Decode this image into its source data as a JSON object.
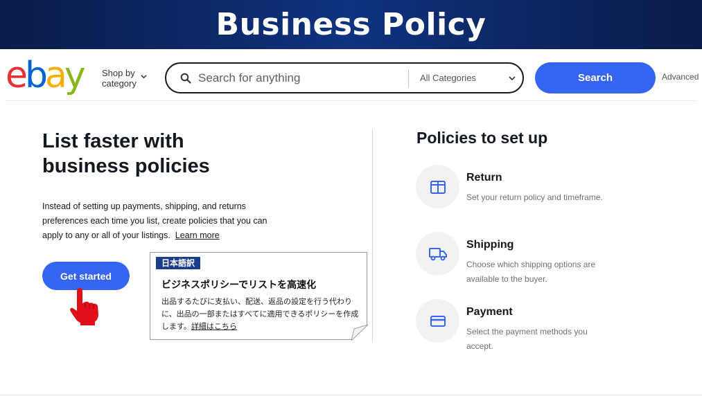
{
  "banner": {
    "title": "Business Policy"
  },
  "header": {
    "logo": {
      "e": "e",
      "b": "b",
      "a": "a",
      "y": "y"
    },
    "shop_by_line1": "Shop by",
    "shop_by_line2": "category",
    "search_placeholder": "Search for anything",
    "category_select": "All Categories",
    "search_button": "Search",
    "advanced_link": "Advanced"
  },
  "hero": {
    "title_line1": "List faster with",
    "title_line2": "business policies",
    "description": "Instead of setting up payments, shipping, and returns preferences each time you list, create policies that you can apply to any or all of your listings.",
    "learn_more": "Learn more",
    "get_started": "Get started"
  },
  "jp_note": {
    "tag": "日本語訳",
    "title": "ビジネスポリシーでリストを高速化",
    "body": "出品するたびに支払い、配送、返品の設定を行う代わりに、出品の一部またはすべてに適用できるポリシーを作成します。",
    "link": "詳細はこちら"
  },
  "policies": {
    "title": "Policies to set up",
    "items": [
      {
        "icon": "box-icon",
        "name": "Return",
        "desc": "Set your return policy and timeframe."
      },
      {
        "icon": "truck-icon",
        "name": "Shipping",
        "desc": "Choose which shipping options are available to the buyer."
      },
      {
        "icon": "card-icon",
        "name": "Payment",
        "desc": "Select the payment methods you accept."
      }
    ]
  },
  "colors": {
    "banner_bg": "#0d2b6d",
    "accent_blue": "#3665f3",
    "pointer_red": "#e0101a",
    "icon_blue": "#3665f3"
  }
}
